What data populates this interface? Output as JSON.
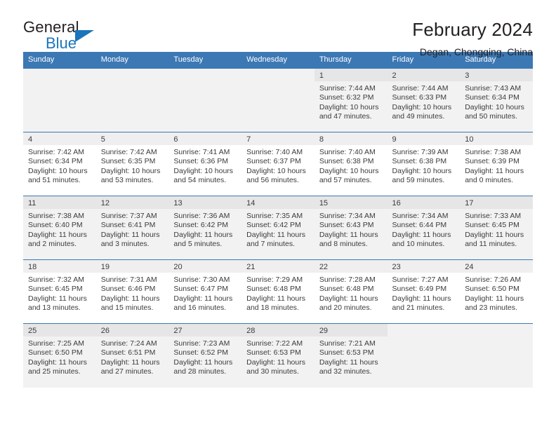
{
  "brand": {
    "name_top": "General",
    "name_bottom": "Blue",
    "triangle_icon": "triangle-icon",
    "accent_color": "#1b75bb"
  },
  "header": {
    "title": "February 2024",
    "subtitle": "Degan, Chongqing, China",
    "header_bg_color": "#3c78b4",
    "header_text_color": "#ffffff"
  },
  "calendar": {
    "weekday_headers": [
      "Sunday",
      "Monday",
      "Tuesday",
      "Wednesday",
      "Thursday",
      "Friday",
      "Saturday"
    ],
    "labels": {
      "sunrise": "Sunrise:",
      "sunset": "Sunset:",
      "daylight": "Daylight:"
    },
    "weeks": [
      [
        {
          "day": ""
        },
        {
          "day": ""
        },
        {
          "day": ""
        },
        {
          "day": ""
        },
        {
          "day": "1",
          "sunrise": "Sunrise: 7:44 AM",
          "sunset": "Sunset: 6:32 PM",
          "daylight_1": "Daylight: 10 hours",
          "daylight_2": "and 47 minutes."
        },
        {
          "day": "2",
          "sunrise": "Sunrise: 7:44 AM",
          "sunset": "Sunset: 6:33 PM",
          "daylight_1": "Daylight: 10 hours",
          "daylight_2": "and 49 minutes."
        },
        {
          "day": "3",
          "sunrise": "Sunrise: 7:43 AM",
          "sunset": "Sunset: 6:34 PM",
          "daylight_1": "Daylight: 10 hours",
          "daylight_2": "and 50 minutes."
        }
      ],
      [
        {
          "day": "4",
          "sunrise": "Sunrise: 7:42 AM",
          "sunset": "Sunset: 6:34 PM",
          "daylight_1": "Daylight: 10 hours",
          "daylight_2": "and 51 minutes."
        },
        {
          "day": "5",
          "sunrise": "Sunrise: 7:42 AM",
          "sunset": "Sunset: 6:35 PM",
          "daylight_1": "Daylight: 10 hours",
          "daylight_2": "and 53 minutes."
        },
        {
          "day": "6",
          "sunrise": "Sunrise: 7:41 AM",
          "sunset": "Sunset: 6:36 PM",
          "daylight_1": "Daylight: 10 hours",
          "daylight_2": "and 54 minutes."
        },
        {
          "day": "7",
          "sunrise": "Sunrise: 7:40 AM",
          "sunset": "Sunset: 6:37 PM",
          "daylight_1": "Daylight: 10 hours",
          "daylight_2": "and 56 minutes."
        },
        {
          "day": "8",
          "sunrise": "Sunrise: 7:40 AM",
          "sunset": "Sunset: 6:38 PM",
          "daylight_1": "Daylight: 10 hours",
          "daylight_2": "and 57 minutes."
        },
        {
          "day": "9",
          "sunrise": "Sunrise: 7:39 AM",
          "sunset": "Sunset: 6:38 PM",
          "daylight_1": "Daylight: 10 hours",
          "daylight_2": "and 59 minutes."
        },
        {
          "day": "10",
          "sunrise": "Sunrise: 7:38 AM",
          "sunset": "Sunset: 6:39 PM",
          "daylight_1": "Daylight: 11 hours",
          "daylight_2": "and 0 minutes."
        }
      ],
      [
        {
          "day": "11",
          "sunrise": "Sunrise: 7:38 AM",
          "sunset": "Sunset: 6:40 PM",
          "daylight_1": "Daylight: 11 hours",
          "daylight_2": "and 2 minutes."
        },
        {
          "day": "12",
          "sunrise": "Sunrise: 7:37 AM",
          "sunset": "Sunset: 6:41 PM",
          "daylight_1": "Daylight: 11 hours",
          "daylight_2": "and 3 minutes."
        },
        {
          "day": "13",
          "sunrise": "Sunrise: 7:36 AM",
          "sunset": "Sunset: 6:42 PM",
          "daylight_1": "Daylight: 11 hours",
          "daylight_2": "and 5 minutes."
        },
        {
          "day": "14",
          "sunrise": "Sunrise: 7:35 AM",
          "sunset": "Sunset: 6:42 PM",
          "daylight_1": "Daylight: 11 hours",
          "daylight_2": "and 7 minutes."
        },
        {
          "day": "15",
          "sunrise": "Sunrise: 7:34 AM",
          "sunset": "Sunset: 6:43 PM",
          "daylight_1": "Daylight: 11 hours",
          "daylight_2": "and 8 minutes."
        },
        {
          "day": "16",
          "sunrise": "Sunrise: 7:34 AM",
          "sunset": "Sunset: 6:44 PM",
          "daylight_1": "Daylight: 11 hours",
          "daylight_2": "and 10 minutes."
        },
        {
          "day": "17",
          "sunrise": "Sunrise: 7:33 AM",
          "sunset": "Sunset: 6:45 PM",
          "daylight_1": "Daylight: 11 hours",
          "daylight_2": "and 11 minutes."
        }
      ],
      [
        {
          "day": "18",
          "sunrise": "Sunrise: 7:32 AM",
          "sunset": "Sunset: 6:45 PM",
          "daylight_1": "Daylight: 11 hours",
          "daylight_2": "and 13 minutes."
        },
        {
          "day": "19",
          "sunrise": "Sunrise: 7:31 AM",
          "sunset": "Sunset: 6:46 PM",
          "daylight_1": "Daylight: 11 hours",
          "daylight_2": "and 15 minutes."
        },
        {
          "day": "20",
          "sunrise": "Sunrise: 7:30 AM",
          "sunset": "Sunset: 6:47 PM",
          "daylight_1": "Daylight: 11 hours",
          "daylight_2": "and 16 minutes."
        },
        {
          "day": "21",
          "sunrise": "Sunrise: 7:29 AM",
          "sunset": "Sunset: 6:48 PM",
          "daylight_1": "Daylight: 11 hours",
          "daylight_2": "and 18 minutes."
        },
        {
          "day": "22",
          "sunrise": "Sunrise: 7:28 AM",
          "sunset": "Sunset: 6:48 PM",
          "daylight_1": "Daylight: 11 hours",
          "daylight_2": "and 20 minutes."
        },
        {
          "day": "23",
          "sunrise": "Sunrise: 7:27 AM",
          "sunset": "Sunset: 6:49 PM",
          "daylight_1": "Daylight: 11 hours",
          "daylight_2": "and 21 minutes."
        },
        {
          "day": "24",
          "sunrise": "Sunrise: 7:26 AM",
          "sunset": "Sunset: 6:50 PM",
          "daylight_1": "Daylight: 11 hours",
          "daylight_2": "and 23 minutes."
        }
      ],
      [
        {
          "day": "25",
          "sunrise": "Sunrise: 7:25 AM",
          "sunset": "Sunset: 6:50 PM",
          "daylight_1": "Daylight: 11 hours",
          "daylight_2": "and 25 minutes."
        },
        {
          "day": "26",
          "sunrise": "Sunrise: 7:24 AM",
          "sunset": "Sunset: 6:51 PM",
          "daylight_1": "Daylight: 11 hours",
          "daylight_2": "and 27 minutes."
        },
        {
          "day": "27",
          "sunrise": "Sunrise: 7:23 AM",
          "sunset": "Sunset: 6:52 PM",
          "daylight_1": "Daylight: 11 hours",
          "daylight_2": "and 28 minutes."
        },
        {
          "day": "28",
          "sunrise": "Sunrise: 7:22 AM",
          "sunset": "Sunset: 6:53 PM",
          "daylight_1": "Daylight: 11 hours",
          "daylight_2": "and 30 minutes."
        },
        {
          "day": "29",
          "sunrise": "Sunrise: 7:21 AM",
          "sunset": "Sunset: 6:53 PM",
          "daylight_1": "Daylight: 11 hours",
          "daylight_2": "and 32 minutes."
        },
        {
          "day": ""
        },
        {
          "day": ""
        }
      ]
    ]
  }
}
